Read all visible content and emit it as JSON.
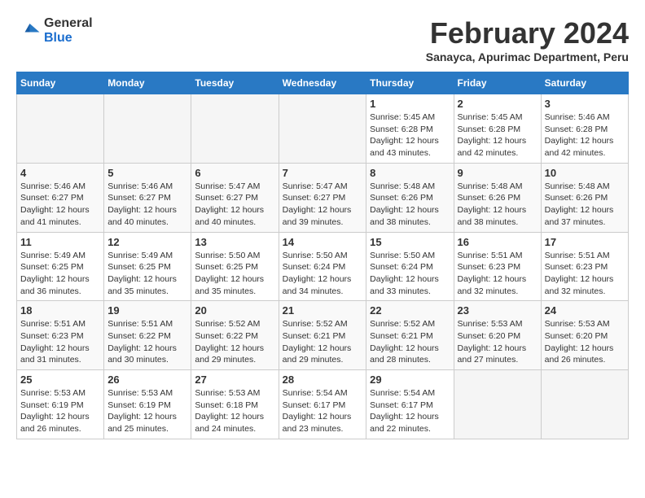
{
  "header": {
    "logo_general": "General",
    "logo_blue": "Blue",
    "title": "February 2024",
    "subtitle": "Sanayca, Apurimac Department, Peru"
  },
  "weekdays": [
    "Sunday",
    "Monday",
    "Tuesday",
    "Wednesday",
    "Thursday",
    "Friday",
    "Saturday"
  ],
  "weeks": [
    [
      {
        "day": "",
        "info": ""
      },
      {
        "day": "",
        "info": ""
      },
      {
        "day": "",
        "info": ""
      },
      {
        "day": "",
        "info": ""
      },
      {
        "day": "1",
        "info": "Sunrise: 5:45 AM\nSunset: 6:28 PM\nDaylight: 12 hours\nand 43 minutes."
      },
      {
        "day": "2",
        "info": "Sunrise: 5:45 AM\nSunset: 6:28 PM\nDaylight: 12 hours\nand 42 minutes."
      },
      {
        "day": "3",
        "info": "Sunrise: 5:46 AM\nSunset: 6:28 PM\nDaylight: 12 hours\nand 42 minutes."
      }
    ],
    [
      {
        "day": "4",
        "info": "Sunrise: 5:46 AM\nSunset: 6:27 PM\nDaylight: 12 hours\nand 41 minutes."
      },
      {
        "day": "5",
        "info": "Sunrise: 5:46 AM\nSunset: 6:27 PM\nDaylight: 12 hours\nand 40 minutes."
      },
      {
        "day": "6",
        "info": "Sunrise: 5:47 AM\nSunset: 6:27 PM\nDaylight: 12 hours\nand 40 minutes."
      },
      {
        "day": "7",
        "info": "Sunrise: 5:47 AM\nSunset: 6:27 PM\nDaylight: 12 hours\nand 39 minutes."
      },
      {
        "day": "8",
        "info": "Sunrise: 5:48 AM\nSunset: 6:26 PM\nDaylight: 12 hours\nand 38 minutes."
      },
      {
        "day": "9",
        "info": "Sunrise: 5:48 AM\nSunset: 6:26 PM\nDaylight: 12 hours\nand 38 minutes."
      },
      {
        "day": "10",
        "info": "Sunrise: 5:48 AM\nSunset: 6:26 PM\nDaylight: 12 hours\nand 37 minutes."
      }
    ],
    [
      {
        "day": "11",
        "info": "Sunrise: 5:49 AM\nSunset: 6:25 PM\nDaylight: 12 hours\nand 36 minutes."
      },
      {
        "day": "12",
        "info": "Sunrise: 5:49 AM\nSunset: 6:25 PM\nDaylight: 12 hours\nand 35 minutes."
      },
      {
        "day": "13",
        "info": "Sunrise: 5:50 AM\nSunset: 6:25 PM\nDaylight: 12 hours\nand 35 minutes."
      },
      {
        "day": "14",
        "info": "Sunrise: 5:50 AM\nSunset: 6:24 PM\nDaylight: 12 hours\nand 34 minutes."
      },
      {
        "day": "15",
        "info": "Sunrise: 5:50 AM\nSunset: 6:24 PM\nDaylight: 12 hours\nand 33 minutes."
      },
      {
        "day": "16",
        "info": "Sunrise: 5:51 AM\nSunset: 6:23 PM\nDaylight: 12 hours\nand 32 minutes."
      },
      {
        "day": "17",
        "info": "Sunrise: 5:51 AM\nSunset: 6:23 PM\nDaylight: 12 hours\nand 32 minutes."
      }
    ],
    [
      {
        "day": "18",
        "info": "Sunrise: 5:51 AM\nSunset: 6:23 PM\nDaylight: 12 hours\nand 31 minutes."
      },
      {
        "day": "19",
        "info": "Sunrise: 5:51 AM\nSunset: 6:22 PM\nDaylight: 12 hours\nand 30 minutes."
      },
      {
        "day": "20",
        "info": "Sunrise: 5:52 AM\nSunset: 6:22 PM\nDaylight: 12 hours\nand 29 minutes."
      },
      {
        "day": "21",
        "info": "Sunrise: 5:52 AM\nSunset: 6:21 PM\nDaylight: 12 hours\nand 29 minutes."
      },
      {
        "day": "22",
        "info": "Sunrise: 5:52 AM\nSunset: 6:21 PM\nDaylight: 12 hours\nand 28 minutes."
      },
      {
        "day": "23",
        "info": "Sunrise: 5:53 AM\nSunset: 6:20 PM\nDaylight: 12 hours\nand 27 minutes."
      },
      {
        "day": "24",
        "info": "Sunrise: 5:53 AM\nSunset: 6:20 PM\nDaylight: 12 hours\nand 26 minutes."
      }
    ],
    [
      {
        "day": "25",
        "info": "Sunrise: 5:53 AM\nSunset: 6:19 PM\nDaylight: 12 hours\nand 26 minutes."
      },
      {
        "day": "26",
        "info": "Sunrise: 5:53 AM\nSunset: 6:19 PM\nDaylight: 12 hours\nand 25 minutes."
      },
      {
        "day": "27",
        "info": "Sunrise: 5:53 AM\nSunset: 6:18 PM\nDaylight: 12 hours\nand 24 minutes."
      },
      {
        "day": "28",
        "info": "Sunrise: 5:54 AM\nSunset: 6:17 PM\nDaylight: 12 hours\nand 23 minutes."
      },
      {
        "day": "29",
        "info": "Sunrise: 5:54 AM\nSunset: 6:17 PM\nDaylight: 12 hours\nand 22 minutes."
      },
      {
        "day": "",
        "info": ""
      },
      {
        "day": "",
        "info": ""
      }
    ]
  ]
}
